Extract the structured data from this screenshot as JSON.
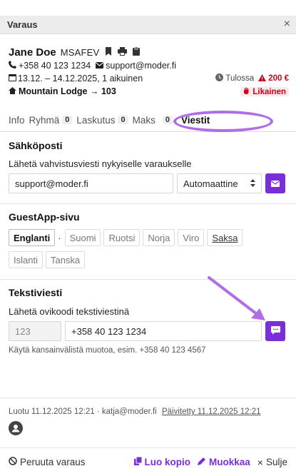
{
  "header": {
    "title": "Varaus",
    "close_label": "×"
  },
  "guest": {
    "name": "Jane Doe",
    "code": "MSAFEV",
    "phone": "+358 40 123 1234",
    "email": "support@moder.fi",
    "dates": "13.12. – 14.12.2025, 1 aikuinen",
    "status": "Tulossa",
    "amount": "200 €",
    "room": "Mountain Lodge → 103",
    "cleaning": "Likainen"
  },
  "tabs": [
    {
      "label": "Info",
      "count": ""
    },
    {
      "label": "Ryhmä",
      "count": "0"
    },
    {
      "label": "Laskutus",
      "count": "0"
    },
    {
      "label": "Maks",
      "count": "0"
    },
    {
      "label": "Viestit",
      "count": ""
    }
  ],
  "email_section": {
    "title": "Sähköposti",
    "subtitle": "Lähetä vahvistusviesti nykyiselle varaukselle",
    "email_value": "support@moder.fi",
    "select_value": "Automaattine"
  },
  "guestapp": {
    "title": "GuestApp-sivu",
    "languages": [
      "Englanti",
      "Suomi",
      "Ruotsi",
      "Norja",
      "Viro",
      "Saksa",
      "Islanti",
      "Tanska"
    ]
  },
  "sms": {
    "title": "Tekstiviesti",
    "subtitle": "Lähetä ovikoodi tekstiviestinä",
    "code_placeholder": "123",
    "phone_value": "+358 40 123 1234",
    "hint": "Käytä kansainvälistä muotoa, esim. +358 40 123 4567"
  },
  "footer": {
    "created": "Luotu 11.12.2025 12:21 · katja@moder.fi",
    "updated": "Päivitetty 11.12.2025 12:21"
  },
  "bottom": {
    "cancel": "Peruuta varaus",
    "copy": "Luo kopio",
    "edit": "Muokkaa",
    "close": "Sulje"
  },
  "colors": {
    "accent": "#7a2fd6",
    "danger": "#d0021b",
    "annotation": "#b06ee6"
  }
}
